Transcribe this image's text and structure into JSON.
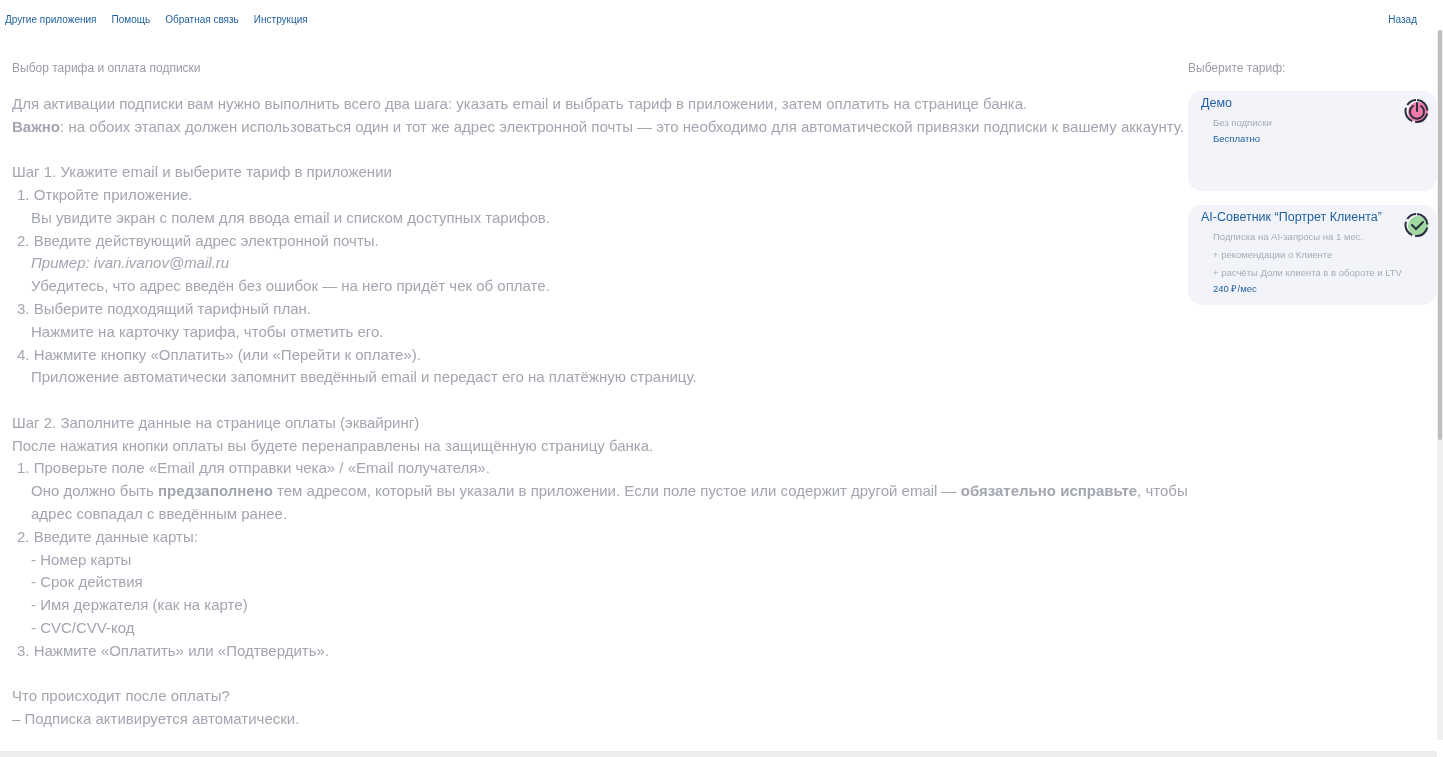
{
  "nav": {
    "links": [
      "Другие приложения",
      "Помощь",
      "Обратная связь",
      "Инструкция"
    ],
    "back": "Назад"
  },
  "main": {
    "title": "Выбор тарифа и оплата подписки",
    "lines": [
      {
        "kind": "p",
        "text": "Для активации подписки вам нужно выполнить всего два шага: указать email и выбрать тариф в приложении, затем оплатить на странице банка."
      },
      {
        "kind": "p",
        "text": "**Важно**: на обоих этапах должен использоваться один и тот же адрес электронной почты — это необходимо для автоматической привязки подписки к вашему аккаунту."
      },
      {
        "kind": "gap"
      },
      {
        "kind": "p",
        "text": "Шаг 1. Укажите email и выберите тариф в приложении"
      },
      {
        "kind": "item",
        "text": "1. Откройте приложение."
      },
      {
        "kind": "sub",
        "text": "Вы увидите экран с полем для ввода email и списком доступных тарифов."
      },
      {
        "kind": "item",
        "text": "2. Введите действующий адрес электронной почты."
      },
      {
        "kind": "example",
        "text": "Пример: ivan.ivanov@mail.ru"
      },
      {
        "kind": "sub",
        "text": "Убедитесь, что адрес введён без ошибок — на него придёт чек об оплате."
      },
      {
        "kind": "item",
        "text": "3. Выберите подходящий тарифный план."
      },
      {
        "kind": "sub",
        "text": "Нажмите на карточку тарифа, чтобы отметить его."
      },
      {
        "kind": "item",
        "text": "4. Нажмите кнопку «Оплатить» (или «Перейти к оплате»)."
      },
      {
        "kind": "sub",
        "text": "Приложение автоматически запомнит введённый email и передаст его на платёжную страницу."
      },
      {
        "kind": "gap"
      },
      {
        "kind": "p",
        "text": "Шаг 2. Заполните данные на странице оплаты (эквайринг)"
      },
      {
        "kind": "p",
        "text": "После нажатия кнопки оплаты вы будете перенаправлены на защищённую страницу банка."
      },
      {
        "kind": "item",
        "text": "1. Проверьте поле «Email для отправки чека» / «Email получателя»."
      },
      {
        "kind": "sub",
        "text": "Оно должно быть **предзаполнено** тем адресом, который вы указали в приложении. Если поле пустое или содержит другой email — **обязательно исправьте**, чтобы адрес совпадал с введённым ранее."
      },
      {
        "kind": "item",
        "text": "2. Введите данные карты:"
      },
      {
        "kind": "sub",
        "text": "- Номер карты"
      },
      {
        "kind": "sub",
        "text": "- Срок действия"
      },
      {
        "kind": "sub",
        "text": "- Имя держателя (как на карте)"
      },
      {
        "kind": "sub",
        "text": "- CVC/CVV-код"
      },
      {
        "kind": "item",
        "text": "3. Нажмите «Оплатить» или «Подтвердить»."
      },
      {
        "kind": "gap"
      },
      {
        "kind": "p",
        "text": "Что происходит после оплаты?"
      },
      {
        "kind": "p",
        "text": "– Подписка активируется автоматически."
      }
    ]
  },
  "tariffs": {
    "title": "Выберите тариф:",
    "cards": [
      {
        "kind": "power",
        "name": "Демо",
        "subtitle": "Без подписки",
        "price": "Бесплатно"
      },
      {
        "kind": "check",
        "name": "AI-Советник “Портрет Клиента”",
        "subtitle": "Подписка на AI-запросы на 1 мес.",
        "features": [
          "+ рекомендации о Клиенте",
          "+ расчёты Доли клиента в в обороте и LTV"
        ],
        "price": "240 ₽/мес"
      }
    ]
  }
}
